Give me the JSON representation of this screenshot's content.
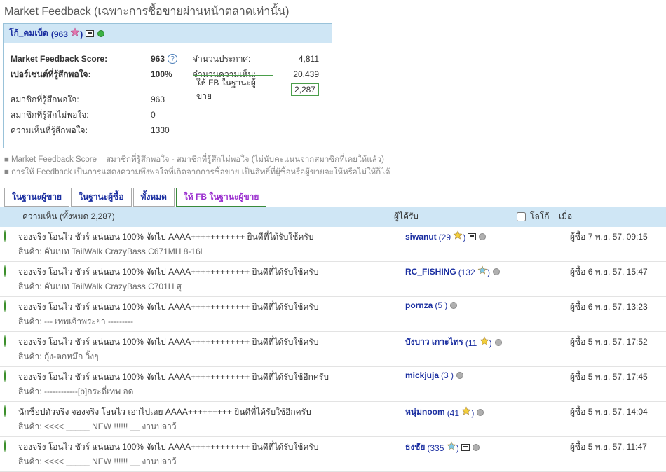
{
  "page_title": "Market Feedback (เฉพาะการซื้อขายผ่านหน้าตลาดเท่านั้น)",
  "summary": {
    "user_name": "โก้_คมเบ็ด",
    "user_score": "963",
    "labels": {
      "score": "Market Feedback Score:",
      "percent": "เปอร์เซนต์ที่รู้สึกพอใจ:",
      "satisfied": "สมาชิกที่รู้สึกพอใจ:",
      "unsatisfied": "สมาชิกที่รู้สึกไม่พอใจ:",
      "opinions": "ความเห็นที่รู้สึกพอใจ:",
      "listings": "จำนวนประกาศ:",
      "comments": "จำนวนความเห็น:",
      "gave_fb": "ให้ FB ในฐานะผู้ขาย"
    },
    "values": {
      "score": "963",
      "percent": "100%",
      "satisfied": "963",
      "unsatisfied": "0",
      "opinions": "1330",
      "listings": "4,811",
      "comments": "20,439",
      "gave_fb": "2,287"
    }
  },
  "footnotes": {
    "l1": "Market Feedback Score = สมาชิกที่รู้สึกพอใจ - สมาชิกที่รู้สึกไม่พอใจ (ไม่นับคะแนนจากสมาชิกที่เคยให้แล้ว)",
    "l2": "การให้ Feedback เป็นการแสดงความพึงพอใจที่เกิดจากการซื้อขาย เป็นสิทธิ์ที่ผู้ซื้อหรือผู้ขายจะให้หรือไม่ให้ก็ได้"
  },
  "tabs": {
    "seller": "ในฐานะผู้ขาย",
    "buyer": "ในฐานะผู้ซื้อ",
    "all": "ทั้งหมด",
    "gave_seller": "ให้ FB ในฐานะผู้ขาย"
  },
  "list_header": {
    "comment": "ความเห็น (ทั้งหมด 2,287)",
    "recipient": "ผู้ได้รับ",
    "logo": "โลโก้",
    "when": "เมื่อ"
  },
  "rows": [
    {
      "comment": "จองจริง โอนไว ชัวร์ แน่นอน 100% จัดไป AAAA+++++++++++ ยินดีที่ได้รับใช้ครับ",
      "product": "สินค้า: คันเบท TailWalk CrazyBass C671MH 8-16l",
      "name": "siwanut",
      "score": "29",
      "star_fill": "#f4d03a",
      "card": true,
      "online": false,
      "when": "ผู้ซื้อ 7 พ.ย. 57, 09:15"
    },
    {
      "comment": "จองจริง โอนไว ชัวร์ แน่นอน 100% จัดไป AAAA++++++++++++ ยินดีที่ได้รับใช้ครับ",
      "product": "สินค้า: คันเบท TailWalk CrazyBass C701H สุ",
      "name": "RC_FISHING",
      "score": "132",
      "star_fill": "#7fc9e8",
      "card": false,
      "online": false,
      "when": "ผู้ซื้อ 6 พ.ย. 57, 15:47"
    },
    {
      "comment": "จองจริง โอนไว ชัวร์ แน่นอน 100% จัดไป AAAA++++++++++++ ยินดีที่ได้รับใช้ครับ",
      "product": "สินค้า: --- เทพเจ้าพระยา ---------",
      "name": "pornza",
      "score": "5",
      "star_fill": "",
      "card": false,
      "online": false,
      "when": "ผู้ซื้อ 6 พ.ย. 57, 13:23"
    },
    {
      "comment": "จองจริง โอนไว ชัวร์ แน่นอน 100% จัดไป AAAA++++++++++++ ยินดีที่ได้รับใช้ครับ",
      "product": "สินค้า: กุ้ง-ตกหมึก วิ้งๆ",
      "name": "บังบาว เกาะไทร",
      "score": "11",
      "star_fill": "#f4d03a",
      "card": false,
      "online": false,
      "when": "ผู้ซื้อ 5 พ.ย. 57, 17:52"
    },
    {
      "comment": "จองจริง โอนไว ชัวร์ แน่นอน 100% จัดไป AAAA++++++++++++ ยินดีที่ได้รับใช้อีกครับ",
      "product": "สินค้า: ------------[b]กระดี่เทพ อด",
      "name": "mickjuja",
      "score": "3",
      "star_fill": "",
      "card": false,
      "online": false,
      "when": "ผู้ซื้อ 5 พ.ย. 57, 17:45"
    },
    {
      "comment": "นักช็อปตัวจริง จองจริง โอนไว เอาไปเลย AAAA+++++++++ ยินดีที่ได้รับใช้อีกครับ",
      "product": "สินค้า: <<<< _____ NEW !!!!!! __ งานปลาว้",
      "name": "หนุ่มnoom",
      "score": "41",
      "star_fill": "#f4d03a",
      "card": false,
      "online": false,
      "when": "ผู้ซื้อ 5 พ.ย. 57, 14:04"
    },
    {
      "comment": "จองจริง โอนไว ชัวร์ แน่นอน 100% จัดไป AAAA++++++++++++ ยินดีที่ได้รับใช้ครับ",
      "product": "สินค้า: <<<< _____ NEW !!!!!! __ งานปลาว้",
      "name": "ธงชัย",
      "score": "335",
      "star_fill": "#7fc9e8",
      "card": true,
      "online": false,
      "when": "ผู้ซื้อ 5 พ.ย. 57, 11:47"
    }
  ]
}
